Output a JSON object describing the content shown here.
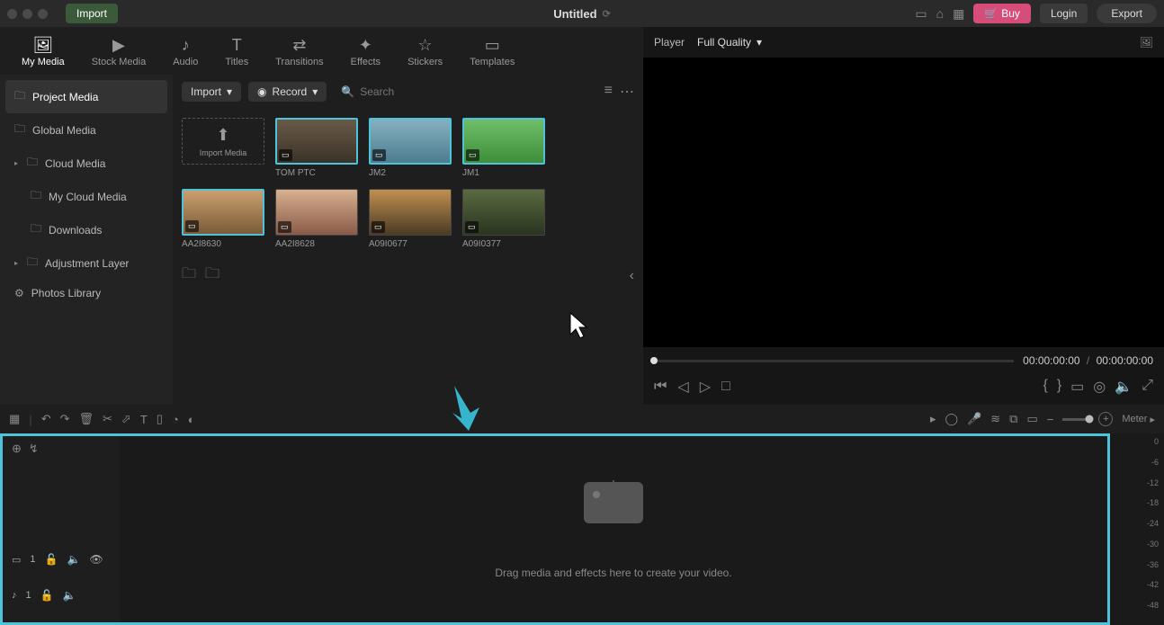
{
  "topbar": {
    "import": "Import",
    "title": "Untitled",
    "buy": "Buy",
    "login": "Login",
    "export": "Export"
  },
  "tabs": [
    {
      "icon": "🖼",
      "label": "My Media"
    },
    {
      "icon": "▶",
      "label": "Stock Media"
    },
    {
      "icon": "♪",
      "label": "Audio"
    },
    {
      "icon": "T",
      "label": "Titles"
    },
    {
      "icon": "⇄",
      "label": "Transitions"
    },
    {
      "icon": "✦",
      "label": "Effects"
    },
    {
      "icon": "☆",
      "label": "Stickers"
    },
    {
      "icon": "▭",
      "label": "Templates"
    }
  ],
  "sidebar": {
    "items": [
      {
        "label": "Project Media",
        "selected": true
      },
      {
        "label": "Global Media"
      },
      {
        "label": "Cloud Media",
        "fold": true
      },
      {
        "label": "My Cloud Media",
        "indent": true
      },
      {
        "label": "Downloads",
        "indent": true
      },
      {
        "label": "Adjustment Layer",
        "fold": true
      },
      {
        "label": "Photos Library",
        "gear": true
      }
    ]
  },
  "mediaToolbar": {
    "import": "Import",
    "record": "Record",
    "searchPlaceholder": "Search"
  },
  "media": {
    "importTile": "Import Media",
    "clips": [
      {
        "label": "TOM PTC",
        "bg": "linear-gradient(#6a5a48,#3a3228)"
      },
      {
        "label": "JM2",
        "bg": "linear-gradient(#86b0c2,#4b7d8e)"
      },
      {
        "label": "JM1",
        "bg": "linear-gradient(#6fbf6a,#3e8e3a)"
      },
      {
        "label": "AA2I8630",
        "bg": "linear-gradient(#caa070,#7a5a38)"
      },
      {
        "label": "AA2I8628",
        "bg": "linear-gradient(#d8b090,#8a5a48)"
      },
      {
        "label": "A09I0677",
        "bg": "linear-gradient(#c09050,#4a3a24)"
      },
      {
        "label": "A09I0377",
        "bg": "linear-gradient(#5a6a40,#2a3420)"
      }
    ]
  },
  "player": {
    "label": "Player",
    "quality": "Full Quality",
    "current": "00:00:00:00",
    "total": "00:00:00:00"
  },
  "timeline": {
    "meterLabel": "Meter",
    "dropText": "Drag media and effects here to create your video.",
    "videoTrack": "1",
    "audioTrack": "1",
    "meterTicks": [
      "0",
      "-6",
      "-12",
      "-18",
      "-24",
      "-30",
      "-36",
      "-42",
      "-48"
    ]
  }
}
